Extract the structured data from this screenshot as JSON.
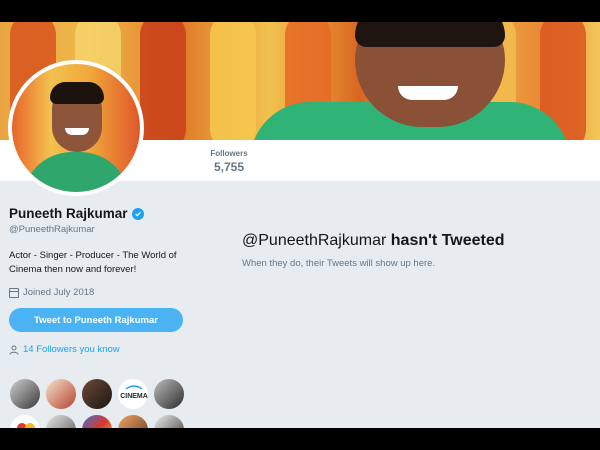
{
  "profile": {
    "name": "Puneeth Rajkumar",
    "handle": "@PuneethRajkumar",
    "bio": "Actor - Singer - Producer - The World of Cinema then now and forever!",
    "joined": "Joined July 2018",
    "tweet_button": "Tweet to Puneeth Rajkumar",
    "followers_you_know": "14 Followers you know"
  },
  "stats": {
    "followers_label": "Followers",
    "followers_value": "5,755"
  },
  "empty_state": {
    "handle": "@PuneethRajkumar",
    "title_suffix": "hasn't Tweeted",
    "subtitle": "When they do, their Tweets will show up here."
  },
  "icons": {
    "verified": "verified-badge-icon",
    "calendar": "calendar-icon",
    "person": "person-icon"
  },
  "colors": {
    "accent": "#1da1f2",
    "button": "#4ab3f4",
    "background": "#e6ecf0",
    "text": "#14171a",
    "muted": "#657786"
  }
}
